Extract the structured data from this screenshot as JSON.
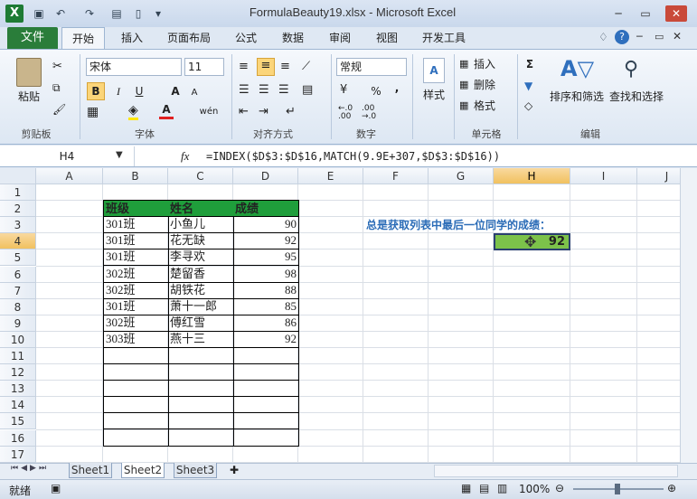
{
  "window": {
    "title": "FormulaBeauty19.xlsx - Microsoft Excel"
  },
  "tabs": [
    "文件",
    "开始",
    "插入",
    "页面布局",
    "公式",
    "数据",
    "审阅",
    "视图",
    "开发工具"
  ],
  "ribbon": {
    "clipboard": {
      "paste": "粘贴",
      "label": "剪贴板"
    },
    "font": {
      "name": "宋体",
      "size": "11",
      "label": "字体",
      "bold": "B",
      "italic": "I",
      "underline": "U",
      "grow": "A",
      "shrink": "A",
      "color": "A",
      "wen": "wén"
    },
    "alignment": {
      "label": "对齐方式"
    },
    "number": {
      "format": "常规",
      "percent": "%",
      "comma": ",",
      "label": "数字"
    },
    "styles": {
      "label": "样式"
    },
    "cells": {
      "insert": "插入",
      "delete": "删除",
      "format": "格式",
      "label": "单元格"
    },
    "editing": {
      "sigma": "Σ",
      "sort": "排序和筛选",
      "find": "查找和选择",
      "label": "编辑"
    }
  },
  "formula_bar": {
    "name_box": "H4",
    "fx": "fx",
    "formula": "=INDEX($D$3:$D$16,MATCH(9.9E+307,$D$3:$D$16))"
  },
  "columns": [
    "A",
    "B",
    "C",
    "D",
    "E",
    "F",
    "G",
    "H",
    "I",
    "J"
  ],
  "rows": [
    "1",
    "2",
    "3",
    "4",
    "5",
    "6",
    "7",
    "8",
    "9",
    "10",
    "11",
    "12",
    "13",
    "14",
    "15",
    "16",
    "17"
  ],
  "table": {
    "headers": [
      "班级",
      "姓名",
      "成绩"
    ],
    "rows": [
      [
        "301班",
        "小鱼儿",
        "90"
      ],
      [
        "301班",
        "花无缺",
        "92"
      ],
      [
        "301班",
        "李寻欢",
        "95"
      ],
      [
        "302班",
        "楚留香",
        "98"
      ],
      [
        "302班",
        "胡铁花",
        "88"
      ],
      [
        "301班",
        "萧十一郎",
        "85"
      ],
      [
        "302班",
        "傅红雪",
        "86"
      ],
      [
        "303班",
        "燕十三",
        "92"
      ],
      [
        "",
        "",
        ""
      ],
      [
        "",
        "",
        ""
      ],
      [
        "",
        "",
        ""
      ],
      [
        "",
        "",
        ""
      ],
      [
        "",
        "",
        ""
      ],
      [
        "",
        "",
        ""
      ]
    ]
  },
  "note": "总是获取列表中最后一位同学的成绩：",
  "result": "92",
  "sheets": [
    "Sheet1",
    "Sheet2",
    "Sheet3"
  ],
  "status": {
    "ready": "就绪",
    "zoom": "100%"
  },
  "colors": {
    "header_green": "#1f9e3b",
    "result_green": "#7cc24a",
    "note_blue": "#2b6cb7",
    "file_tab": "#2a7d3a"
  }
}
